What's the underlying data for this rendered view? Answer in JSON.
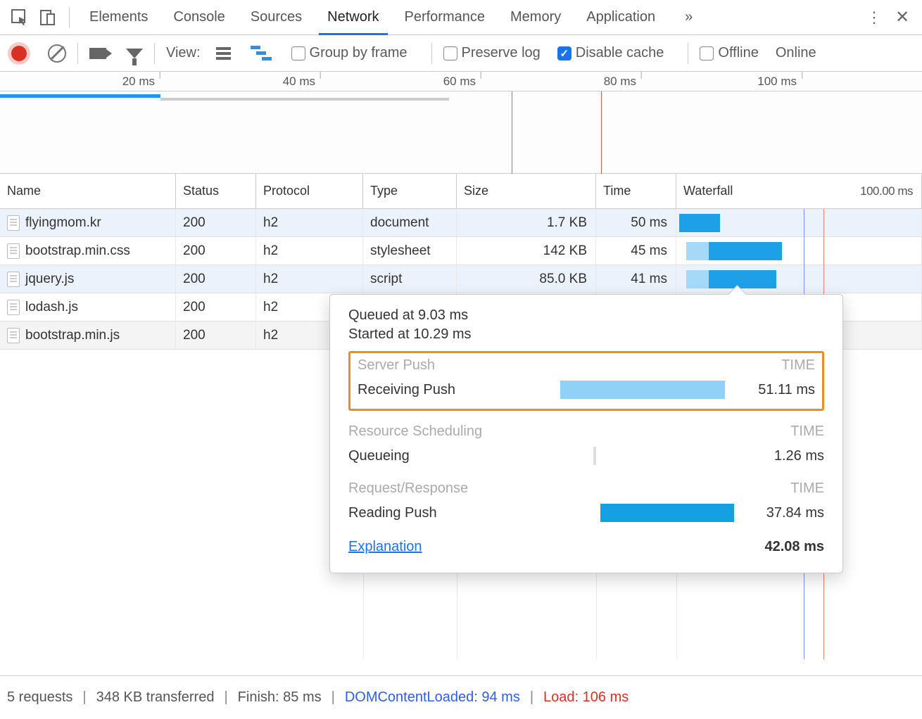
{
  "tabs": {
    "elements": "Elements",
    "console": "Console",
    "sources": "Sources",
    "network": "Network",
    "performance": "Performance",
    "memory": "Memory",
    "application": "Application",
    "more": "»"
  },
  "toolbar": {
    "view_label": "View:",
    "group_by_frame": "Group by frame",
    "preserve_log": "Preserve log",
    "disable_cache": "Disable cache",
    "offline": "Offline",
    "online": "Online"
  },
  "overview": {
    "ticks": [
      "20 ms",
      "40 ms",
      "60 ms",
      "80 ms",
      "100 ms"
    ]
  },
  "columns": {
    "name": "Name",
    "status": "Status",
    "protocol": "Protocol",
    "type": "Type",
    "size": "Size",
    "time": "Time",
    "waterfall": "Waterfall",
    "wf_max": "100.00 ms"
  },
  "rows": [
    {
      "name": "flyingmom.kr",
      "status": "200",
      "protocol": "h2",
      "type": "document",
      "size": "1.7 KB",
      "time": "50 ms"
    },
    {
      "name": "bootstrap.min.css",
      "status": "200",
      "protocol": "h2",
      "type": "stylesheet",
      "size": "142 KB",
      "time": "45 ms"
    },
    {
      "name": "jquery.js",
      "status": "200",
      "protocol": "h2",
      "type": "script",
      "size": "85.0 KB",
      "time": "41 ms"
    },
    {
      "name": "lodash.js",
      "status": "200",
      "protocol": "h2",
      "type": "",
      "size": "",
      "time": ""
    },
    {
      "name": "bootstrap.min.js",
      "status": "200",
      "protocol": "h2",
      "type": "",
      "size": "",
      "time": ""
    }
  ],
  "popover": {
    "queued": "Queued at 9.03 ms",
    "started": "Started at 10.29 ms",
    "server_push_header": "Server Push",
    "time_header": "TIME",
    "receiving_push": "Receiving Push",
    "receiving_push_val": "51.11 ms",
    "resource_scheduling": "Resource Scheduling",
    "queueing": "Queueing",
    "queueing_val": "1.26 ms",
    "request_response": "Request/Response",
    "reading_push": "Reading Push",
    "reading_push_val": "37.84 ms",
    "explanation": "Explanation",
    "total": "42.08 ms"
  },
  "status": {
    "requests": "5 requests",
    "transferred": "348 KB transferred",
    "finish": "Finish: 85 ms",
    "dcl": "DOMContentLoaded: 94 ms",
    "load": "Load: 106 ms"
  },
  "chart_data": {
    "type": "table",
    "title": "Network timing detail for jquery.js",
    "queued_at_ms": 9.03,
    "started_at_ms": 10.29,
    "phases": [
      {
        "group": "Server Push",
        "name": "Receiving Push",
        "duration_ms": 51.11
      },
      {
        "group": "Resource Scheduling",
        "name": "Queueing",
        "duration_ms": 1.26
      },
      {
        "group": "Request/Response",
        "name": "Reading Push",
        "duration_ms": 37.84
      }
    ],
    "total_ms": 42.08,
    "waterfall_max_ms": 100.0
  }
}
